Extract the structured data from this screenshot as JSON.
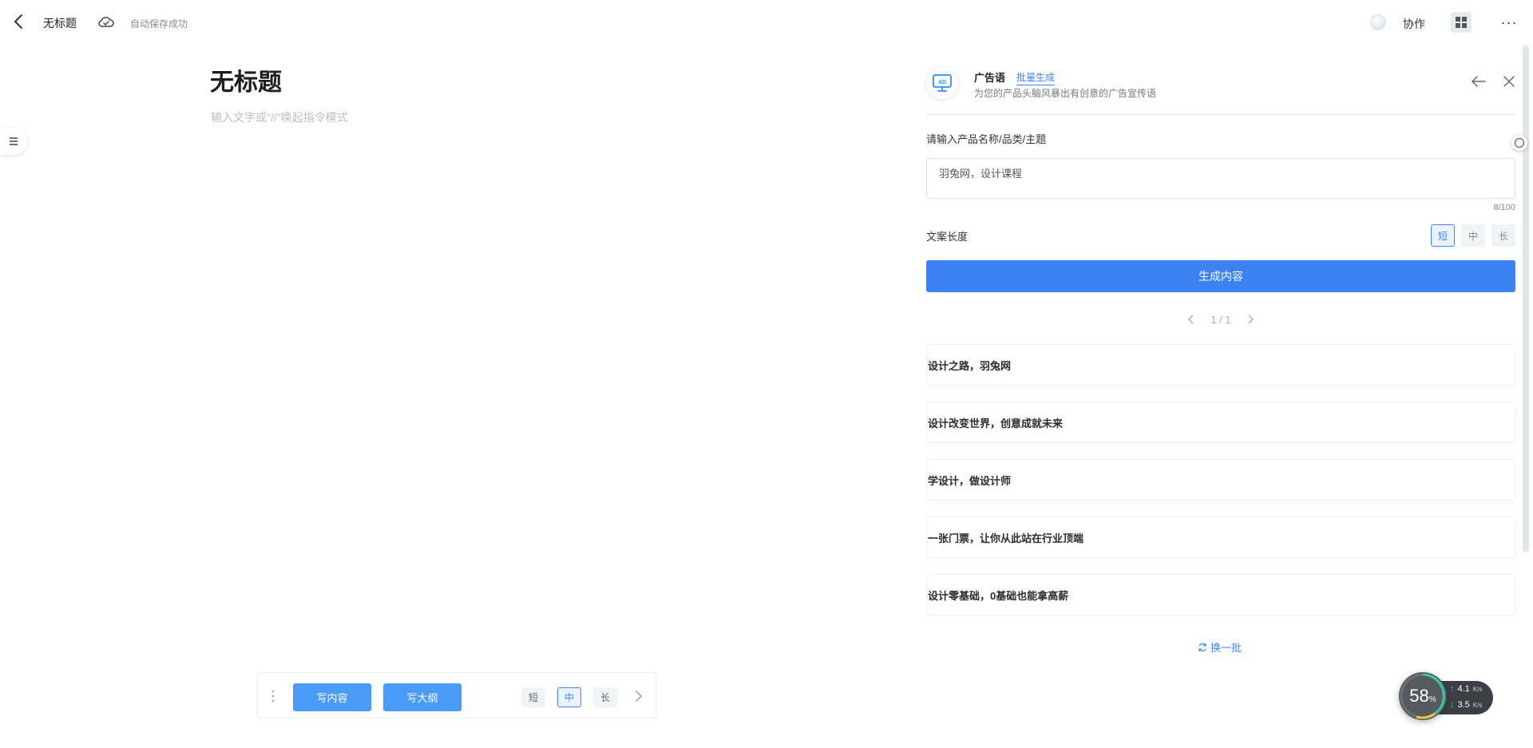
{
  "topbar": {
    "doc_title": "无标题",
    "save_status": "自动保存成功",
    "collab_label": "协作",
    "more_label": "···"
  },
  "editor": {
    "title": "无标题",
    "placeholder": "输入文字或\"//\"唤起指令模式"
  },
  "bottom_toolbar": {
    "write_content": "写内容",
    "write_outline": "写大纲",
    "lengths": [
      "短",
      "中",
      "长"
    ],
    "active_length": "中"
  },
  "panel": {
    "name": "广告语",
    "batch_link": "批量生成",
    "description": "为您的产品头脑风暴出有创意的广告宣传语",
    "input_label": "请输入产品名称/品类/主题",
    "input_value": "羽兔网，设计课程",
    "counter": "8/100",
    "length_label": "文案长度",
    "lengths": [
      "短",
      "中",
      "长"
    ],
    "active_length": "短",
    "generate_label": "生成内容",
    "pager": "1 / 1",
    "results": [
      "设计之路，羽兔网",
      "设计改变世界，创意成就未来",
      "学设计，做设计师",
      "一张门票，让你从此站在行业顶端",
      "设计零基础，0基础也能拿高薪"
    ],
    "refresh_label": "换一批"
  },
  "net_widget": {
    "percent": "58",
    "percent_unit": "%",
    "upload": "4.1",
    "download": "3.5",
    "unit": "K/s"
  },
  "colors": {
    "accent": "#3d82f5",
    "accent_light": "#4a9af7"
  }
}
